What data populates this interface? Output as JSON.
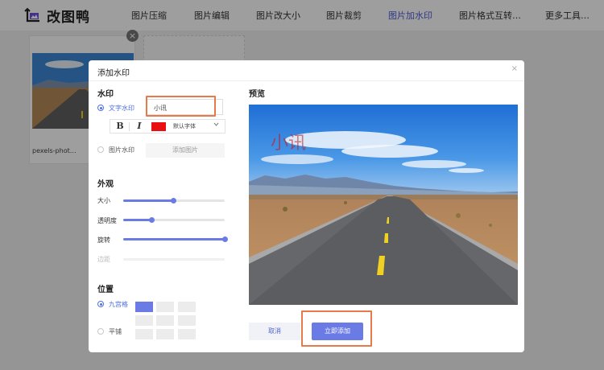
{
  "app": {
    "name": "改图鸭"
  },
  "nav": {
    "items": [
      {
        "label": "图片压缩"
      },
      {
        "label": "图片编辑"
      },
      {
        "label": "图片改大小"
      },
      {
        "label": "图片裁剪"
      },
      {
        "label": "图片加水印",
        "active": true
      },
      {
        "label": "图片格式互转…"
      },
      {
        "label": "更多工具…"
      }
    ]
  },
  "workspace": {
    "file_name": "pexels-phot…",
    "close_glyph": "×"
  },
  "modal": {
    "title": "添加水印",
    "close_glyph": "×",
    "watermark": {
      "section_title": "水印",
      "text_option": {
        "label": "文字水印",
        "selected": true
      },
      "text_value": "小讯",
      "format": {
        "bold": "B",
        "italic": "I",
        "color": "#e81010",
        "font": "默认字体"
      },
      "image_option": {
        "label": "图片水印",
        "selected": false
      },
      "add_image_label": "添加图片"
    },
    "appearance": {
      "section_title": "外观",
      "sliders": [
        {
          "label": "大小",
          "value": 0.49,
          "enabled": true
        },
        {
          "label": "透明度",
          "value": 0.28,
          "enabled": true
        },
        {
          "label": "旋转",
          "value": 1.0,
          "enabled": true
        },
        {
          "label": "边距",
          "value": 0.0,
          "enabled": false
        }
      ]
    },
    "position": {
      "section_title": "位置",
      "grid_option": {
        "label": "九宫格",
        "selected": true
      },
      "tile_option": {
        "label": "平铺",
        "selected": false
      },
      "selected_cell": 0
    },
    "preview": {
      "title": "预览",
      "watermark_text": "小讯"
    },
    "buttons": {
      "cancel": "取消",
      "apply": "立即添加"
    }
  },
  "colors": {
    "accent": "#6b7be6",
    "highlight": "#e8794b",
    "watermark": "#e81010"
  }
}
